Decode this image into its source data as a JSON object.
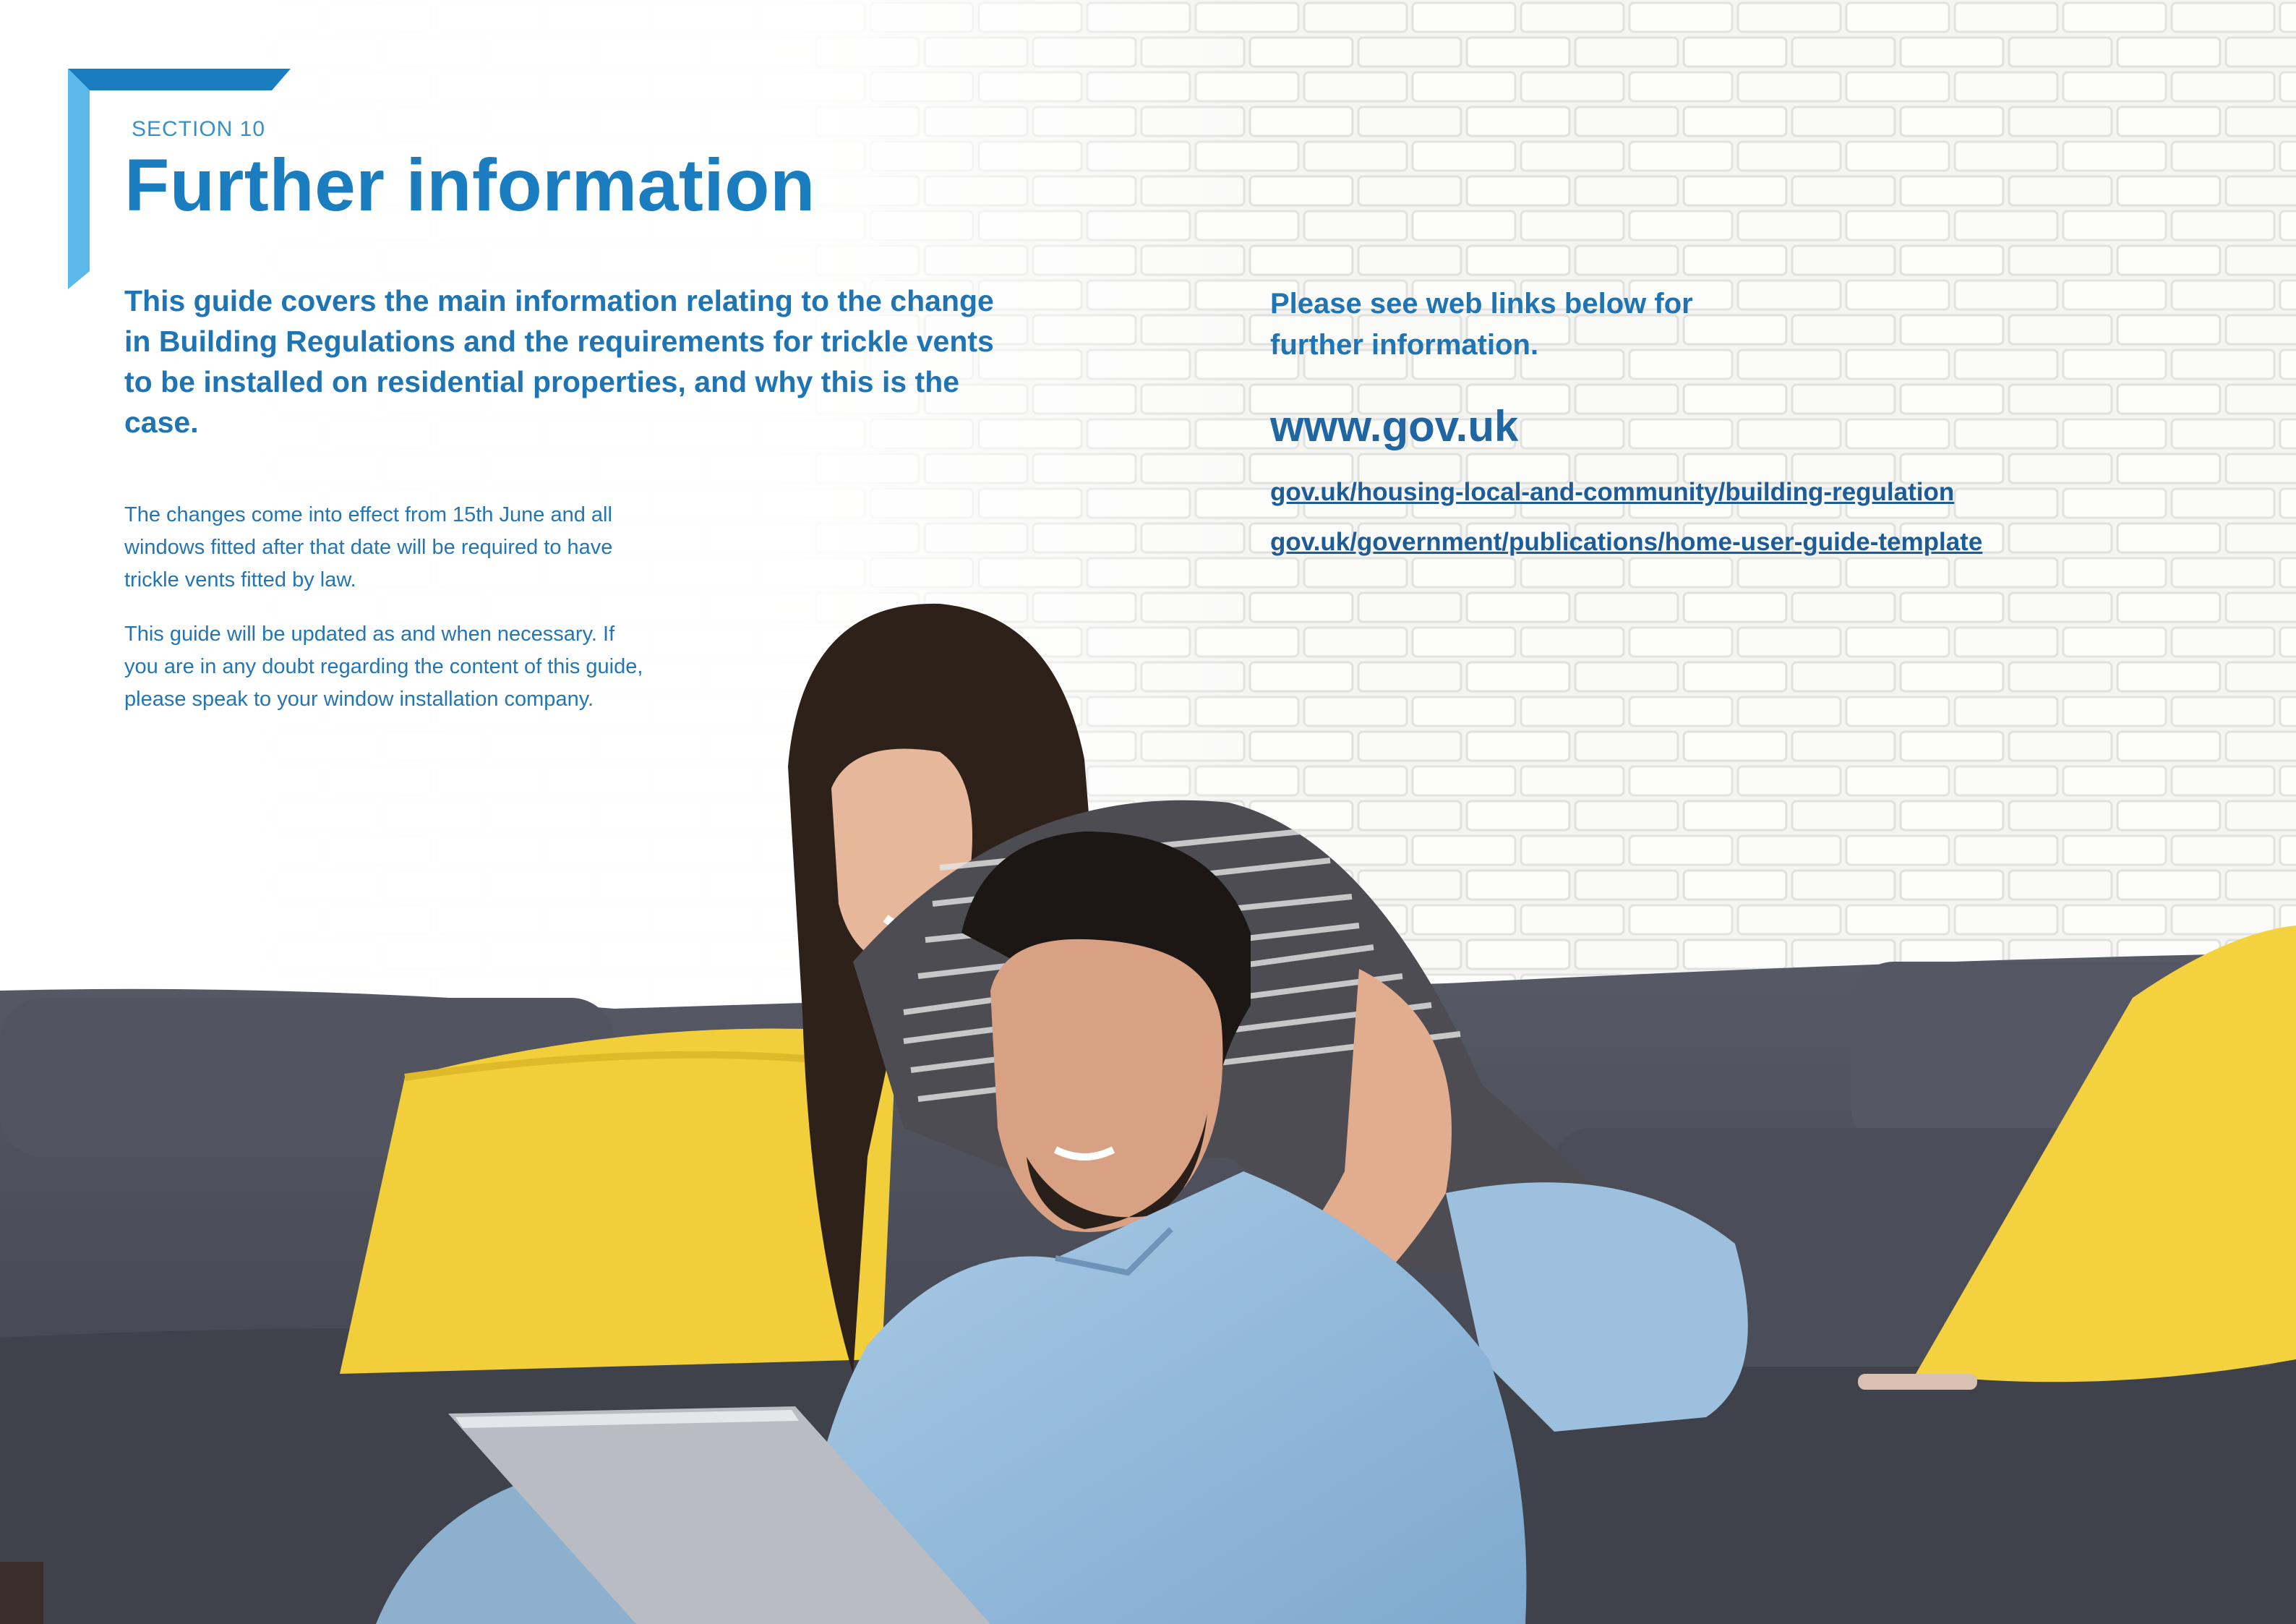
{
  "section": {
    "label": "SECTION 10",
    "title": "Further information"
  },
  "intro": "This guide covers the main information relating to the change in Building Regulations and the requirements for trickle vents to be installed on residential properties, and why this is the case.",
  "paragraphs": [
    "The changes come into effect from 15th June and all windows fitted after that date will be required to have trickle vents fitted by law.",
    "This guide will be updated as and when necessary. If you are in any doubt regarding the content of this guide, please speak to your window installation company."
  ],
  "links": {
    "intro": "Please see web links below for further information.",
    "site": "www.gov.uk",
    "items": [
      "gov.uk/housing-local-and-community/building-regulation",
      "gov.uk/government/publications/home-user-guide-template"
    ]
  },
  "colors": {
    "accent_blue": "#1a7dbf",
    "light_blue": "#5bb8ea",
    "link_blue": "#1d5c97",
    "sofa_grey": "#4a4c57",
    "cushion_yellow": "#f2cf3a"
  }
}
